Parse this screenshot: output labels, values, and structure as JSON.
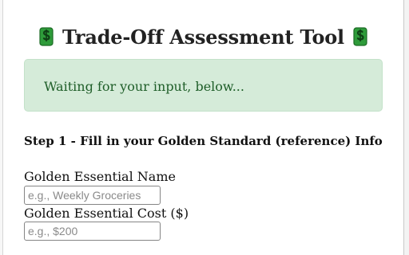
{
  "header": {
    "title": "Trade-Off Assessment Tool",
    "icon_left": "money-bag-icon",
    "icon_right": "money-bag-icon"
  },
  "status": {
    "message": "Waiting for your input, below..."
  },
  "step1": {
    "heading": "Step 1 - Fill in your Golden Standard (reference) Info",
    "name_label": "Golden Essential Name",
    "name_placeholder": "e.g., Weekly Groceries",
    "name_value": "",
    "cost_label": "Golden Essential Cost ($)",
    "cost_placeholder": "e.g., $200",
    "cost_value": ""
  },
  "colors": {
    "alert_background": "#d5ebd9",
    "alert_text": "#1f5e29",
    "icon_green": "#2e9b3a"
  }
}
